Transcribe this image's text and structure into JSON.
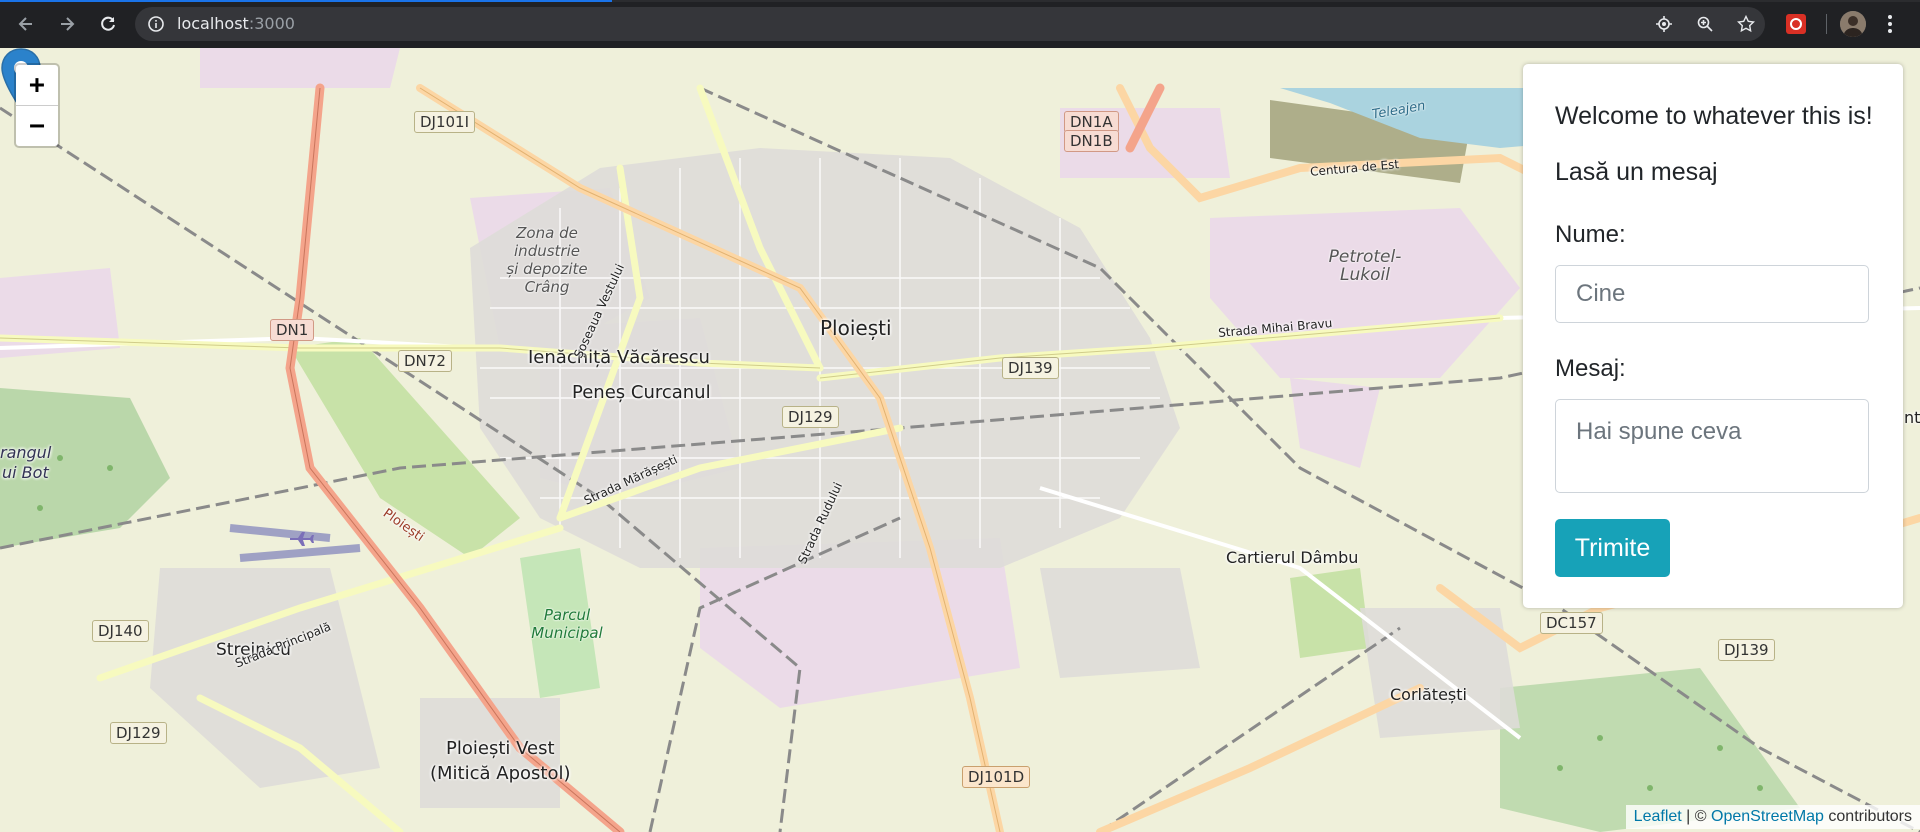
{
  "browser": {
    "url_host": "localhost",
    "url_port": ":3000",
    "icons": [
      "back-icon",
      "forward-icon",
      "reload-icon",
      "info-icon",
      "location-icon",
      "zoom-icon",
      "star-icon",
      "extension-icon",
      "profile-avatar",
      "menu-icon"
    ]
  },
  "map": {
    "zoom_in": "+",
    "zoom_out": "−",
    "labels": {
      "ploiesti": "Ploiești",
      "ienachita": "Ienăchiță Văcărescu",
      "penes": "Peneș Curcanul",
      "cartierul": "Cartierul Dâmbu",
      "strejnicu": "Strejnicu",
      "corlatesti": "Corlătești",
      "ploiesti_vest": "Ploiești Vest",
      "mitica": "(Mitică Apostol)",
      "crangul1": "rangul",
      "crangul2": "ui Bot",
      "zona1": "Zona de",
      "zona2": "industrie",
      "zona3": "și depozite",
      "zona4": "Crâng",
      "parcul1": "Parcul",
      "parcul2": "Municipal",
      "petrotel1": "Petrotel-",
      "petrotel2": "Lukoil",
      "teleajen": "Teleajen",
      "centura": "Centura de Est",
      "strada_mihai": "Strada Mihai Bravu",
      "strada_principala": "Strada Principală",
      "strada_marasesti": "Strada Mărășești",
      "strada_ruddului": "Strada Rudului",
      "soseaua_vestului": "Șoseaua Vestului",
      "ploiesti_road": "Ploiești",
      "ntu": "nta"
    },
    "shields": {
      "dj101i": "DJ101I",
      "dn1a": "DN1A",
      "dn1b": "DN1B",
      "dn1": "DN1",
      "dn72": "DN72",
      "dj139a": "DJ139",
      "dj129a": "DJ129",
      "dj140": "DJ140",
      "dj129b": "DJ129",
      "dc157": "DC157",
      "dj139b": "DJ139",
      "dj101d": "DJ101D"
    }
  },
  "panel": {
    "welcome": "Welcome to whatever this is!",
    "subtitle": "Lasă un mesaj",
    "name_label": "Nume:",
    "name_placeholder": "Cine",
    "message_label": "Mesaj:",
    "message_placeholder": "Hai spune ceva",
    "submit": "Trimite"
  },
  "attribution": {
    "leaflet": "Leaflet",
    "sep": " | © ",
    "osm": "OpenStreetMap",
    "suffix": " contributors"
  },
  "colors": {
    "button": "#17a2b8",
    "marker": "#2b82cb",
    "link": "#0078a8"
  }
}
